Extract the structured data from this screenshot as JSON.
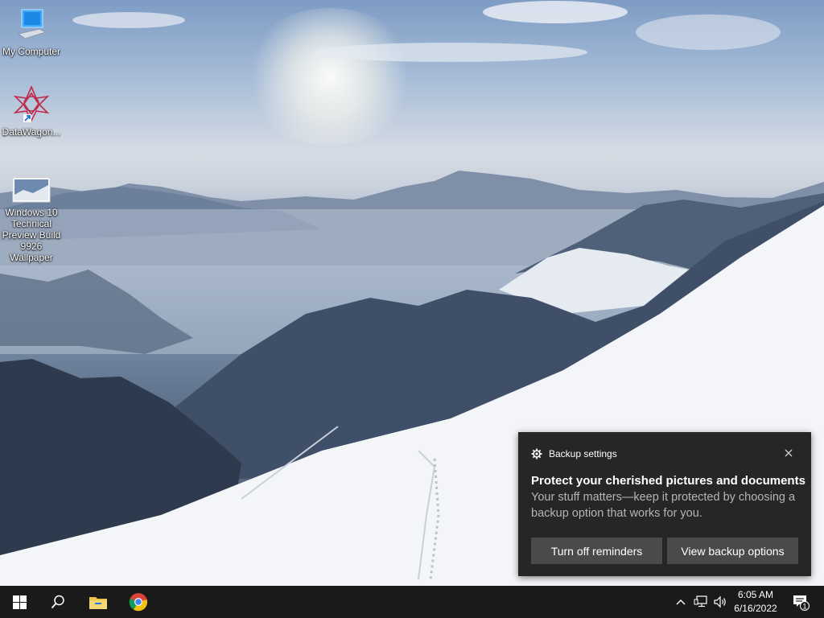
{
  "desktop": {
    "icons": [
      {
        "label": "My Computer"
      },
      {
        "label": "DataWagon..."
      },
      {
        "label": "Windows 10 Technical Preview Build 9926 Wallpaper"
      }
    ]
  },
  "toast": {
    "app_name": "Backup settings",
    "title": "Protect your cherished pictures and documents",
    "body": "Your stuff matters—keep it protected by choosing a backup option that works for you.",
    "buttons": {
      "turn_off": "Turn off reminders",
      "view_options": "View backup options"
    },
    "close_icon": "close-icon",
    "app_icon": "gear-icon"
  },
  "taskbar": {
    "start_icon": "windows-logo-icon",
    "search_icon": "search-icon",
    "pinned": [
      "file-explorer-icon",
      "chrome-icon"
    ],
    "tray": {
      "chevron_icon": "chevron-up-icon",
      "network_icon": "network-icon",
      "volume_icon": "volume-icon",
      "time": "6:05 AM",
      "date": "6/16/2022",
      "notification_count": "1"
    }
  },
  "colors": {
    "taskbar": "#1a1a1a",
    "toast_bg": "#262626",
    "toast_button": "#4a4a4a"
  }
}
